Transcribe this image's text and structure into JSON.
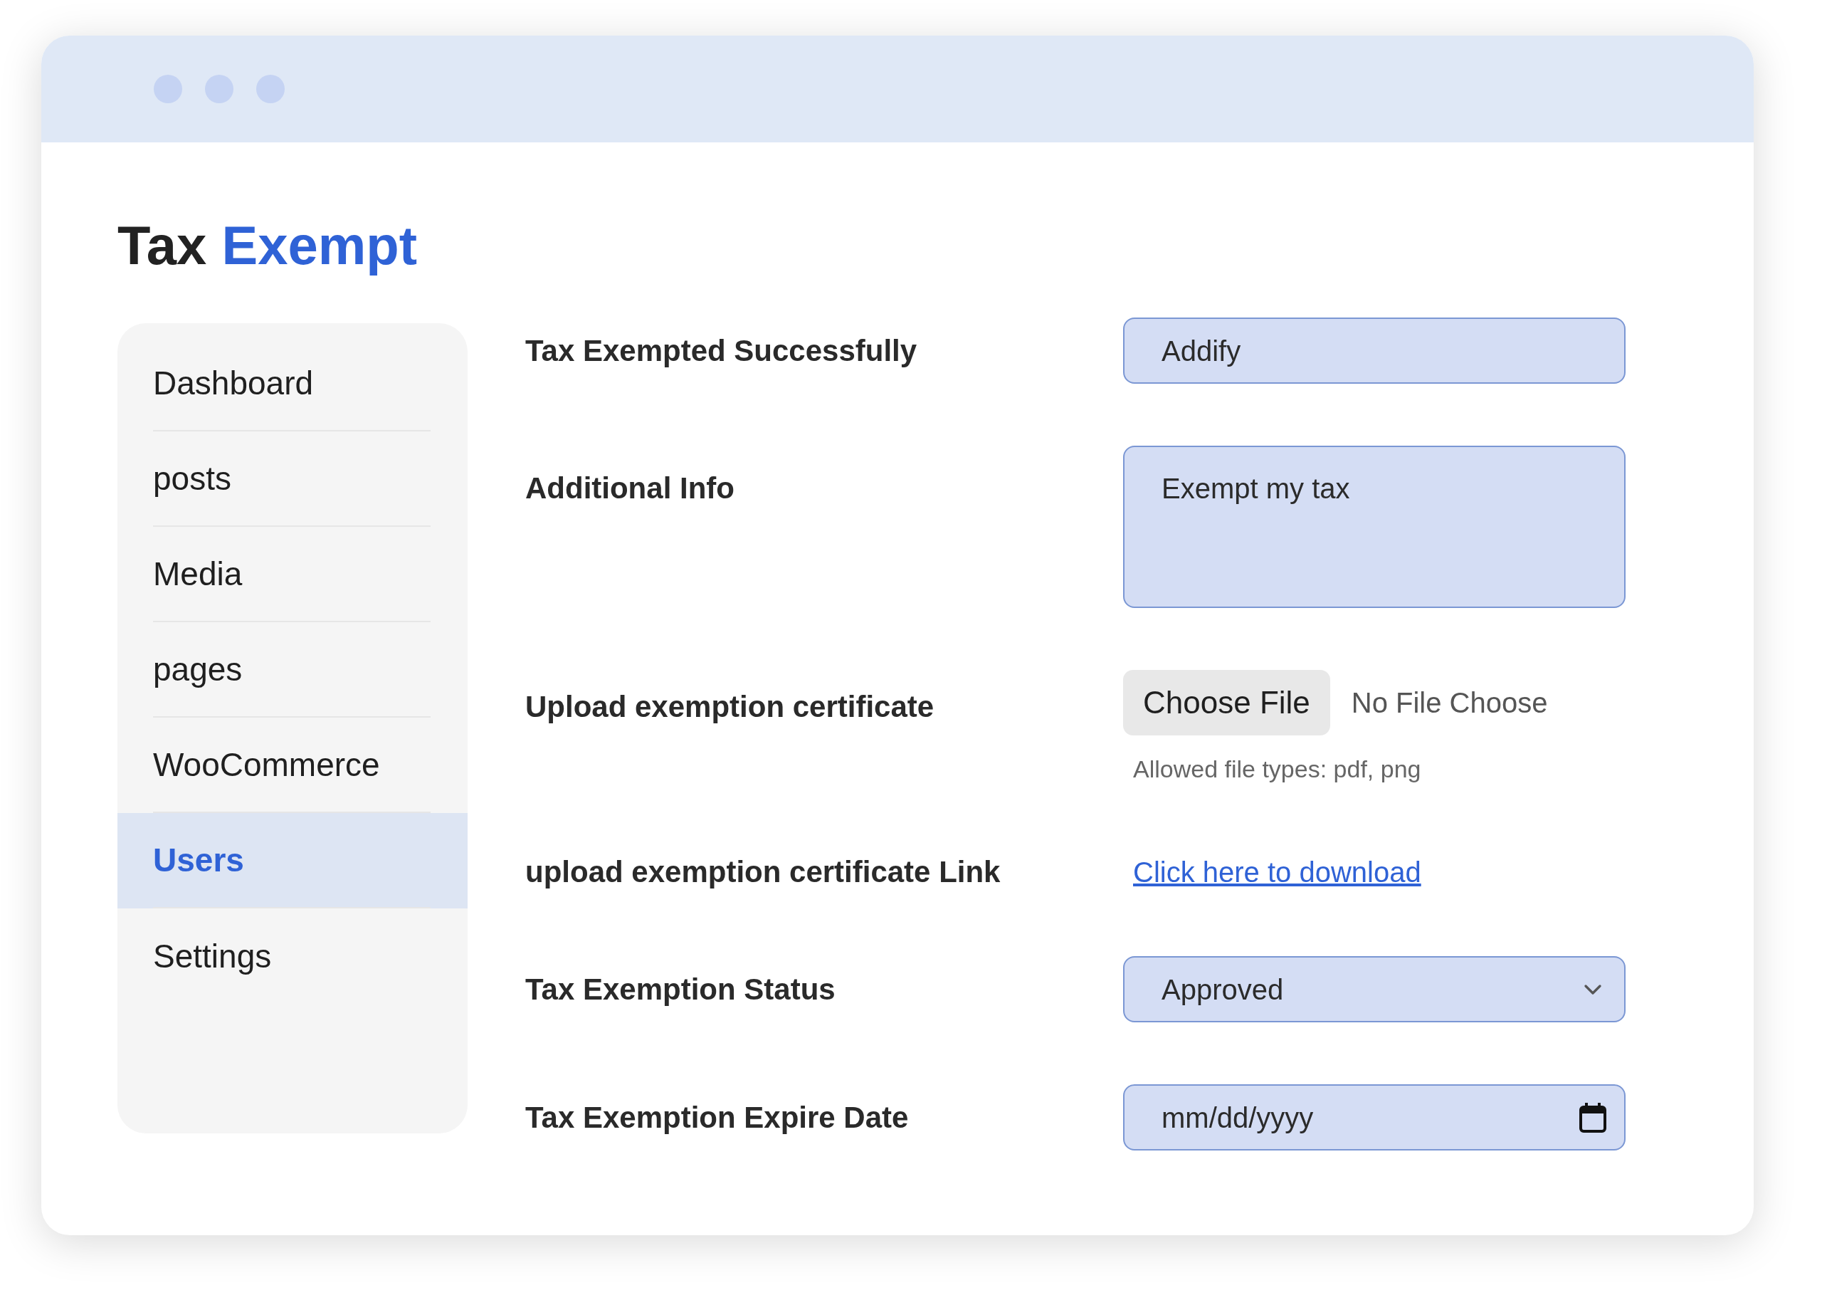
{
  "title": {
    "first": "Tax",
    "second": "Exempt"
  },
  "sidebar": {
    "items": [
      {
        "label": "Dashboard",
        "selected": false
      },
      {
        "label": "posts",
        "selected": false
      },
      {
        "label": "Media",
        "selected": false
      },
      {
        "label": "pages",
        "selected": false
      },
      {
        "label": "WooCommerce",
        "selected": false
      },
      {
        "label": "Users",
        "selected": true
      },
      {
        "label": "Settings",
        "selected": false
      }
    ]
  },
  "form": {
    "rows": [
      {
        "kind": "text",
        "label": "Tax Exempted Successfully",
        "value": "Addify"
      },
      {
        "kind": "textarea",
        "label": "Additional Info",
        "value": "Exempt my tax"
      },
      {
        "kind": "file",
        "label": "Upload exemption certificate",
        "button": "Choose File",
        "status": "No File Choose",
        "hint": "Allowed file types: pdf, png"
      },
      {
        "kind": "link",
        "label": "upload exemption certificate Link",
        "value": "Click here to download"
      },
      {
        "kind": "select",
        "label": "Tax Exemption Status",
        "value": "Approved"
      },
      {
        "kind": "date",
        "label": "Tax Exemption Expire Date",
        "value": "mm/dd/yyyy"
      }
    ]
  }
}
